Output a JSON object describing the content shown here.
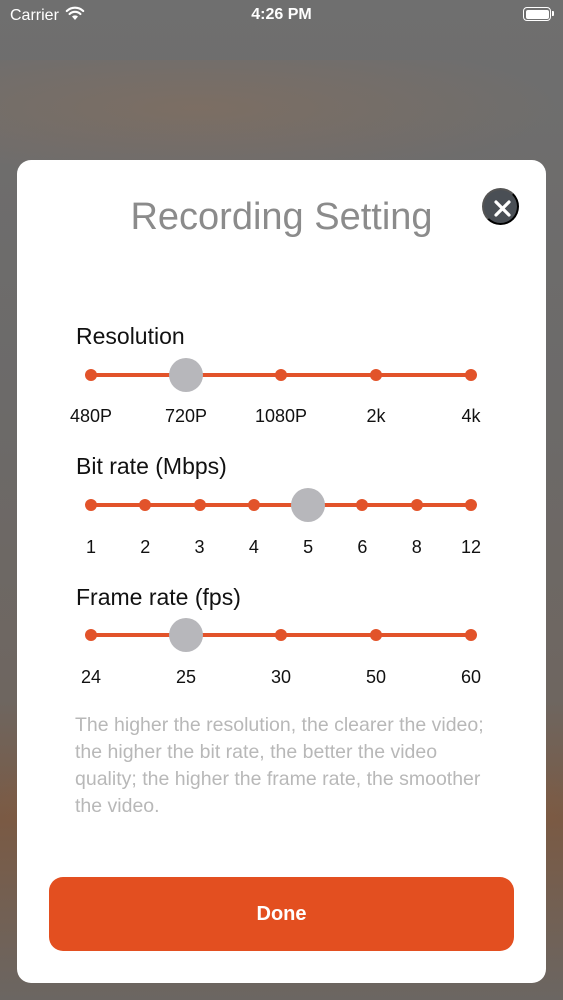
{
  "status_bar": {
    "carrier": "Carrier",
    "time": "4:26 PM",
    "battery_level": 1.0
  },
  "modal": {
    "title": "Recording Setting",
    "close_icon": "close-x-icon",
    "done_label": "Done",
    "description": "The higher the resolution, the clearer the video; the higher the bit rate, the better the video quality; the higher the frame rate, the smoother the video."
  },
  "sliders": {
    "resolution": {
      "label": "Resolution",
      "options": [
        "480P",
        "720P",
        "1080P",
        "2k",
        "4k"
      ],
      "selected_index": 1
    },
    "bitrate": {
      "label": "Bit rate (Mbps)",
      "options": [
        "1",
        "2",
        "3",
        "4",
        "5",
        "6",
        "8",
        "12"
      ],
      "selected_index": 4
    },
    "framerate": {
      "label": "Frame rate (fps)",
      "options": [
        "24",
        "25",
        "30",
        "50",
        "60"
      ],
      "selected_index": 1
    }
  },
  "colors": {
    "accent": "#e34f20",
    "thumb": "#b7b7bb",
    "title": "#8b8b8b",
    "description": "#b8b8b8",
    "close_bg": "#4a4f55"
  }
}
